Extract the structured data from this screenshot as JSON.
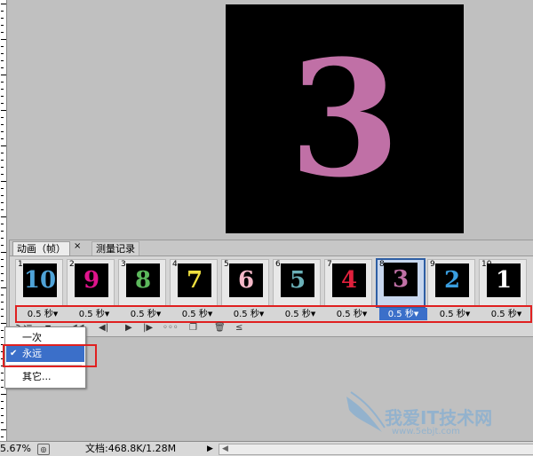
{
  "canvas": {
    "digit": "3",
    "digit_color": "#c070a6"
  },
  "panel": {
    "tabs": [
      {
        "label": "动画（帧）"
      },
      {
        "label": "测量记录"
      }
    ],
    "tab_close": "×",
    "frames": [
      {
        "number": "1",
        "digit": "10",
        "color": "#4fa3d8"
      },
      {
        "number": "2",
        "digit": "9",
        "color": "#e0148c"
      },
      {
        "number": "3",
        "digit": "8",
        "color": "#5cb85c"
      },
      {
        "number": "4",
        "digit": "7",
        "color": "#f0e040"
      },
      {
        "number": "5",
        "digit": "6",
        "color": "#f4b8c8"
      },
      {
        "number": "6",
        "digit": "5",
        "color": "#6ab0b8"
      },
      {
        "number": "7",
        "digit": "4",
        "color": "#e0203c"
      },
      {
        "number": "8",
        "digit": "3",
        "color": "#c070a6"
      },
      {
        "number": "9",
        "digit": "2",
        "color": "#3a9ee0"
      },
      {
        "number": "10",
        "digit": "1",
        "color": "#ffffff"
      }
    ],
    "selected_frame": "8",
    "durations": [
      "0.5 秒",
      "0.5 秒",
      "0.5 秒",
      "0.5 秒",
      "0.5 秒",
      "0.5 秒",
      "0.5 秒",
      "0.5 秒",
      "0.5 秒",
      "0.5 秒"
    ],
    "loop_label": "永远"
  },
  "loop_menu": {
    "items": [
      {
        "label": "一次"
      },
      {
        "label": "永远"
      },
      {
        "label": "其它..."
      }
    ],
    "selected": "永远"
  },
  "status": {
    "zoom": "5.67%",
    "doc_info": "文档:468.8K/1.28M"
  },
  "watermark": {
    "text": "我爱IT技术网",
    "url": "www.5ebjt.com"
  },
  "colors": {
    "accent": "#3b6fc9",
    "highlight_box": "#e02020"
  }
}
